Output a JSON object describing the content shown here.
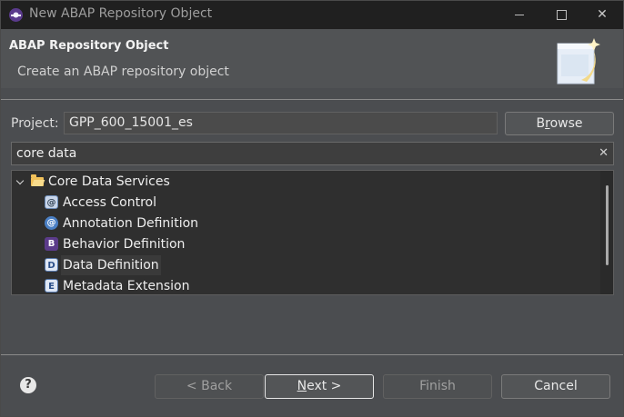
{
  "window": {
    "title": "New ABAP Repository Object"
  },
  "header": {
    "title": "ABAP Repository Object",
    "description": "Create an ABAP repository object"
  },
  "project": {
    "label": "Project:",
    "value": "GPP_600_15001_es",
    "browse_prefix": "B",
    "browse_mnemonic": "r",
    "browse_suffix": "owse"
  },
  "filter": {
    "value": "core data",
    "clear_icon": "close-icon"
  },
  "tree": {
    "folder": {
      "label": "Core Data Services",
      "icon": "folder-open-icon",
      "expanded": true
    },
    "items": [
      {
        "label": "Access Control",
        "icon": "access-control-icon",
        "glyph": "@"
      },
      {
        "label": "Annotation Definition",
        "icon": "annotation-definition-icon",
        "glyph": "@"
      },
      {
        "label": "Behavior Definition",
        "icon": "behavior-definition-icon",
        "glyph": "B"
      },
      {
        "label": "Data Definition",
        "icon": "data-definition-icon",
        "glyph": "D",
        "selected": true
      },
      {
        "label": "Metadata Extension",
        "icon": "metadata-extension-icon",
        "glyph": "E"
      }
    ]
  },
  "buttons": {
    "back": "< Back",
    "next_mnemonic": "N",
    "next_rest": "ext >",
    "finish": "Finish",
    "cancel": "Cancel"
  },
  "colors": {
    "titlebar": "#202020",
    "dialog_bg": "#4b4d50",
    "tree_bg": "#2f2f2f",
    "folder": "#f1c15a"
  }
}
